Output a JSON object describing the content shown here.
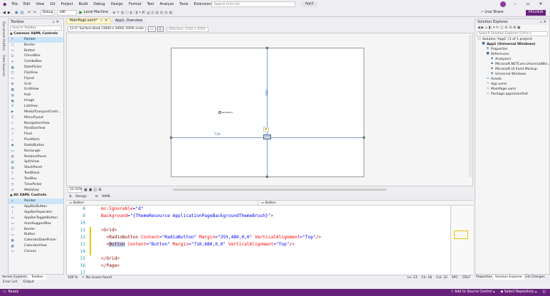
{
  "menu": [
    "File",
    "Edit",
    "View",
    "Git",
    "Project",
    "Build",
    "Debug",
    "Design",
    "Format",
    "Test",
    "Analyze",
    "Tools",
    "Extensions",
    "Window",
    "Help"
  ],
  "search_placeholder": "Search (Ctrl+Q)",
  "app_name": "App1",
  "toolbar": {
    "config": "Debug",
    "platform": "x86",
    "run_target": "Local Machine",
    "live_share": "Live Share",
    "preview": "PREVIEW"
  },
  "left_strip": [
    "Document Outline",
    "Data Sources"
  ],
  "toolbox": {
    "title": "Toolbox",
    "search": "Search Toolbox",
    "group1": "Common XAML Controls",
    "items1": [
      "Pointer",
      "Border",
      "Button",
      "CheckBox",
      "ComboBox",
      "DatePicker",
      "FlipView",
      "Flyout",
      "Grid",
      "GridView",
      "Hub",
      "Image",
      "ListView",
      "MediaTransportContr...",
      "MenuFlyout",
      "NavigationView",
      "PassBoxView",
      "Pivot",
      "PivotItem",
      "RadioButton",
      "Rectangle",
      "RelativePanel",
      "SplitView",
      "StackPanel",
      "TextBlock",
      "TextBox",
      "TimePicker",
      "WebView"
    ],
    "group2": "All XAML Controls",
    "items2": [
      "Pointer",
      "AppBarButton",
      "AppBarSeparator",
      "AppBarToggleButton",
      "AutoSuggestBox",
      "Border",
      "Button",
      "CalendarDatePicker",
      "CalendarView",
      "Canvas"
    ],
    "bottom_tabs": [
      "Server Explorer",
      "Toolbox"
    ]
  },
  "doc_tabs": [
    "MainPage.xaml*",
    "App1: Overview"
  ],
  "design": {
    "device": "13.5\" Surface Book (3000 x 2000) 200% scale",
    "effective": "Effective: 1500 x 1000",
    "radio_label": "RadioButton",
    "dim_710": "710",
    "dim_680": "680",
    "zoom": "22.25%",
    "split_tabs": [
      "Design",
      "XAML"
    ],
    "xaml_element": "Button",
    "xaml_element_right": "Button"
  },
  "code": [
    {
      "n": "8",
      "parts": [
        [
          "a",
          "mc:Ignorable"
        ],
        [
          "v",
          "=\"d\""
        ]
      ]
    },
    {
      "n": "9",
      "parts": [
        [
          "a",
          "Background"
        ],
        [
          "v",
          "=\"{ThemeResource ApplicationPageBackgroundThemeBrush}\""
        ],
        [
          "k",
          ">"
        ]
      ]
    },
    {
      "n": "10",
      "parts": []
    },
    {
      "n": "11",
      "parts": [
        [
          "k",
          "<"
        ],
        [
          "t",
          "Grid"
        ],
        [
          "k",
          ">"
        ]
      ]
    },
    {
      "n": "12",
      "parts": [
        [
          "k",
          "  <"
        ],
        [
          "t",
          "RadioButton"
        ],
        [
          "a",
          " Content"
        ],
        [
          "v",
          "=\"RadioButton\""
        ],
        [
          "a",
          " Margin"
        ],
        [
          "v",
          "=\"355,480,0,0\""
        ],
        [
          "a",
          " VerticalAlignment"
        ],
        [
          "v",
          "=\"Top\""
        ],
        [
          "k",
          "/>"
        ]
      ]
    },
    {
      "n": "13",
      "parts": [
        [
          "k",
          "  <"
        ],
        [
          "t",
          "Button"
        ],
        [
          "a",
          " Content"
        ],
        [
          "v",
          "=\"Button\""
        ],
        [
          "a",
          " Margin"
        ],
        [
          "v",
          "=\"710,680,0,0\""
        ],
        [
          "a",
          " VerticalAlignment"
        ],
        [
          "v",
          "=\"Top\""
        ],
        [
          "k",
          "/>"
        ]
      ]
    },
    {
      "n": "14",
      "parts": []
    },
    {
      "n": "15",
      "parts": [
        [
          "k",
          "</"
        ],
        [
          "t",
          "Grid"
        ],
        [
          "k",
          ">"
        ]
      ]
    },
    {
      "n": "16",
      "parts": [
        [
          "k",
          "</"
        ],
        [
          "t",
          "Page"
        ],
        [
          "k",
          ">"
        ]
      ]
    },
    {
      "n": "17",
      "parts": []
    }
  ],
  "editor_status": {
    "zoom": "100 %",
    "issues": "No issues found",
    "ln": "Ln: 13",
    "ch": "Ch: 16",
    "col": "Col: 22",
    "spc": "SPC",
    "crlf": "CRLF"
  },
  "solution": {
    "title": "Solution Explorer",
    "search": "Search Solution Explorer (Ctrl+;)",
    "items": [
      {
        "t": "Solution 'App1' (1 of 1 project)",
        "i": "□",
        "lvl": 0
      },
      {
        "t": "App1 (Universal Windows)",
        "i": "■",
        "lvl": 1,
        "bold": true
      },
      {
        "t": "Properties",
        "i": "⚙",
        "lvl": 2
      },
      {
        "t": "References",
        "i": "■",
        "lvl": 2
      },
      {
        "t": "Analyzers",
        "i": "▪",
        "lvl": 3
      },
      {
        "t": "Microsoft.NETCore.UniversalWin...",
        "i": "▪",
        "lvl": 3
      },
      {
        "t": "Microsoft.UI.Xaml.Markup",
        "i": "▪",
        "lvl": 3
      },
      {
        "t": "Universal Windows",
        "i": "▪",
        "lvl": 3
      },
      {
        "t": "Assets",
        "i": "▭",
        "lvl": 2
      },
      {
        "t": "App.xaml",
        "i": "▫",
        "lvl": 2
      },
      {
        "t": "MainPage.xaml",
        "i": "▫",
        "lvl": 2
      },
      {
        "t": "Package.appxmanifest",
        "i": "▫",
        "lvl": 2
      }
    ],
    "bottom_tabs": [
      "Properties",
      "Solution Explorer",
      "Git Changes"
    ]
  },
  "output_tabs": [
    "Error List",
    "Output"
  ],
  "status": {
    "ready": "Ready",
    "add_source": "↑ Add to Source Control ▴",
    "select_repo": "◆ Select Repository ▴"
  },
  "colors": {
    "accent": "#68217a",
    "selection": "#cce4f7"
  }
}
